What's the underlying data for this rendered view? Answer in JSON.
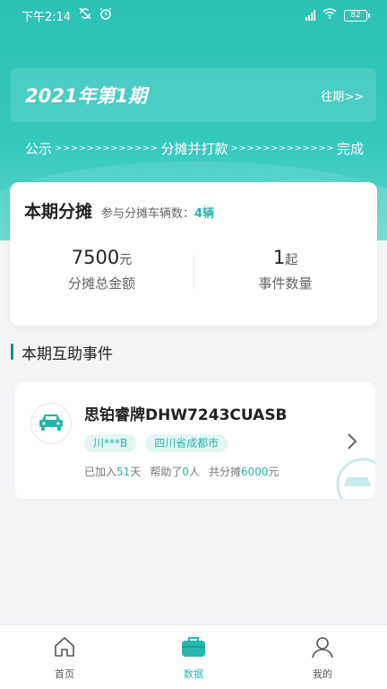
{
  "status_bar": {
    "time": "下午2:14",
    "battery": "82"
  },
  "period": {
    "title": "2021年第1期",
    "history_link": "往期>>"
  },
  "steps": [
    {
      "label": "公示"
    },
    {
      "arrows": ">>>>>>>>>>>>>"
    },
    {
      "label": "分摊并打款"
    },
    {
      "arrows": ">>>>>>>>>>>>>"
    },
    {
      "label": "完成"
    }
  ],
  "summary": {
    "title": "本期分摊",
    "participants_prefix": "参与分摊车辆数：",
    "participants_value": "4辆",
    "amount_value": "7500",
    "amount_unit": "元",
    "amount_label": "分摊总金额",
    "events_value": "1",
    "events_unit": "起",
    "events_label": "事件数量"
  },
  "section": {
    "title": "本期互助事件"
  },
  "event": {
    "name": "思铂睿牌DHW7243CUASB",
    "tags": [
      "川***B",
      "四川省成都市"
    ],
    "joined_prefix": "已加入",
    "joined_days": "51",
    "joined_suffix": "天",
    "helped_prefix": "帮助了",
    "helped_count": "0",
    "helped_suffix": "人",
    "shared_prefix": "共分摊",
    "shared_amount": "6000",
    "shared_suffix": "元"
  },
  "nav": {
    "items": [
      {
        "label": "首页",
        "icon": "home-icon"
      },
      {
        "label": "数据",
        "icon": "briefcase-icon"
      },
      {
        "label": "我的",
        "icon": "user-icon"
      }
    ],
    "active": "数据"
  },
  "colors": {
    "accent": "#27b6aa",
    "header": "#2cc2b5"
  }
}
